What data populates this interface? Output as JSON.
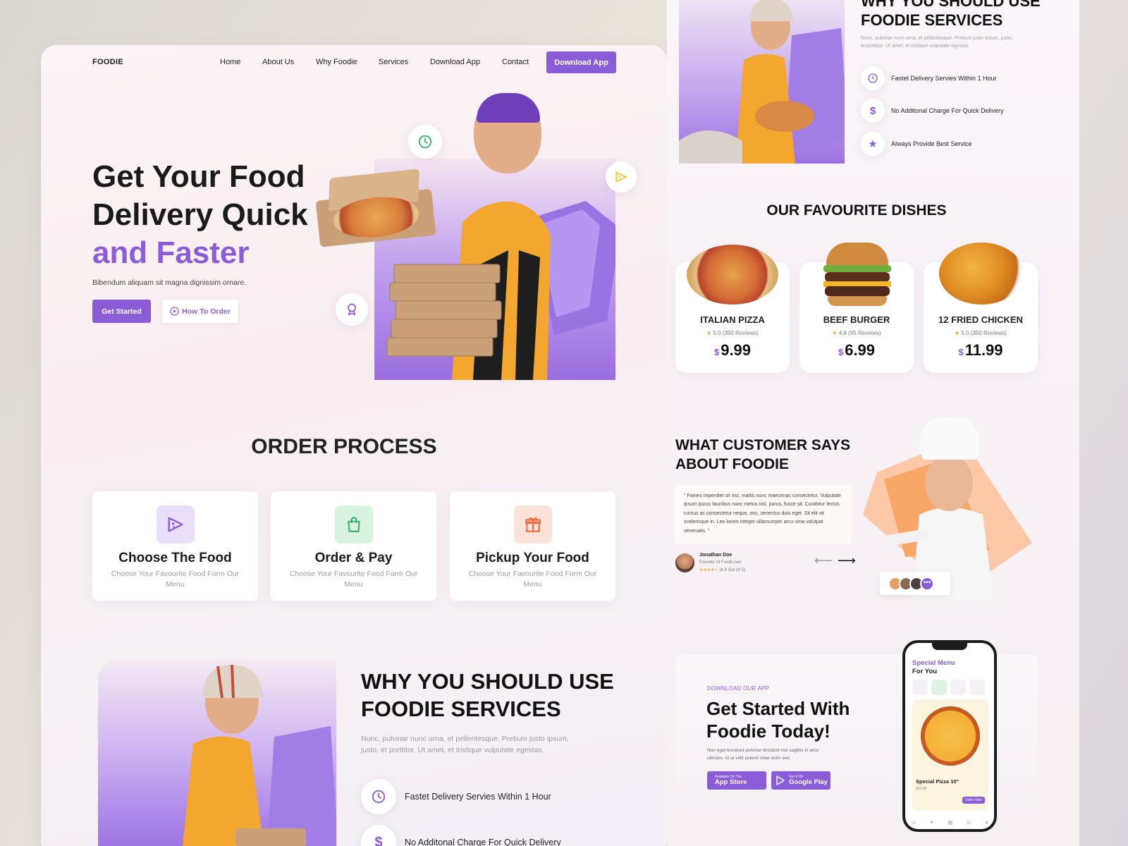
{
  "brand": "FOODIE",
  "nav": {
    "items": [
      "Home",
      "About Us",
      "Why Foodie",
      "Services",
      "Download App",
      "Contact"
    ],
    "cta": "Download App"
  },
  "hero": {
    "title_line1": "Get Your Food",
    "title_line2": "Delivery Quick",
    "title_line3": "and Faster",
    "subtitle": "Bibendum aliquam sit magna dignissim ornare.",
    "primary_btn": "Get Started",
    "secondary_btn": "How To Order"
  },
  "order_process": {
    "title": "ORDER PROCESS",
    "steps": [
      {
        "title": "Choose The Food",
        "desc": "Choose Your Favourite Food Form Our Menu"
      },
      {
        "title": "Order & Pay",
        "desc": "Choose Your Favourite Food Form Our Menu"
      },
      {
        "title": "Pickup Your Food",
        "desc": "Choose Your Favourite Food Form Our Menu"
      }
    ]
  },
  "why": {
    "title_line1": "WHY YOU SHOULD USE",
    "title_line2": "FOODIE SERVICES",
    "desc": "Nunc, pulvinar nunc urna, et pellentesque. Pretium justo ipsum, justo, et porttitor. Ut amet, et tristique vulputate egestas.",
    "features": [
      {
        "label": "Fastet Delivery Servies Within 1 Hour",
        "icon": "clock-icon"
      },
      {
        "label": "No Additonal Charge For Quick Delivery",
        "icon": "dollar-icon"
      },
      {
        "label": "Always Provide Best Service",
        "icon": "star-icon"
      }
    ]
  },
  "dishes": {
    "title": "OUR FAVOURITE DISHES",
    "currency": "$",
    "items": [
      {
        "name": "ITALIAN PIZZA",
        "reviews": "5.0 (350 Reviews)",
        "price": "9.99"
      },
      {
        "name": "BEEF BURGER",
        "reviews": "4.8 (95 Reviews)",
        "price": "6.99"
      },
      {
        "name": "12 FRIED CHICKEN",
        "reviews": "5.0 (350 Reviews)",
        "price": "11.99"
      }
    ]
  },
  "testimonial": {
    "title_line1": "WHAT CUSTOMER SAYS",
    "title_line2": "ABOUT FOODIE",
    "quote": "\" Fames imperdiet sit nisl, mattis nunc maecenas consectetur. Vulputate ipsum purus faucibus nunc metus nisl, purus, fusce sit. Curabitur lectus cursus ac consectetur neque, orci, senectus duis eget. Sit elit sit scelerisque in. Leo lorem integer ullamcorper arcu urna volutpat venenatis. \"",
    "name": "Jonathan Doe",
    "role": "Founder At FoodLover",
    "rating": "(4.9 Out Of 5)"
  },
  "app": {
    "eyebrow": "DOWNLOAD OUR APP",
    "title_line1": "Get Started With",
    "title_line2": "Foodie Today!",
    "desc": "Non eget tincidunt pulvinar tincidunt nisl sagittis in arcu ultricies. Id at velit potenti vitae enim sed.",
    "appstore_small": "Available On The",
    "appstore_big": "App Store",
    "play_small": "Get It On",
    "play_big": "Google Play",
    "phone": {
      "heading1": "Special Menu",
      "heading2": "For You",
      "item_name": "Special Pizza 10\"",
      "item_price": "$16.99",
      "order_btn": "Order Now"
    }
  },
  "colors": {
    "accent": "#8a5cd8",
    "green": "#3bb36b",
    "orange": "#f26a3c"
  }
}
